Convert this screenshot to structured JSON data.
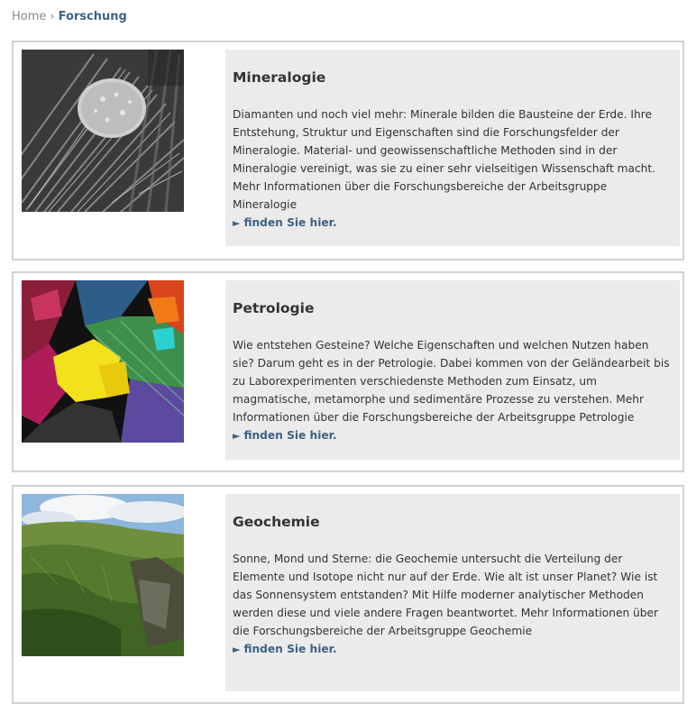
{
  "breadcrumb": {
    "home": "Home",
    "separator": "›",
    "current": "Forschung"
  },
  "cards": [
    {
      "title": "Mineralogie",
      "text": "Diamanten und noch viel mehr: Minerale bilden die Bausteine der Erde. Ihre Entstehung, Struktur und Eigenschaften sind die Forschungsfelder der Mineralogie. Material- und geowissenschaftliche Methoden sind in der Mineralogie vereinigt, was sie zu einer sehr vielseitigen Wissenschaft macht. Mehr Informationen über die Forschungsbereiche der Arbeitsgruppe Mineralogie",
      "link_arrow": "►",
      "link_label": "finden Sie hier."
    },
    {
      "title": "Petrologie",
      "text": "Wie entstehen Gesteine? Welche Eigenschaften und welchen Nutzen haben sie? Darum geht es in der Petrologie. Dabei kommen von der Geländearbeit bis zu Laborexperimenten verschiedenste Methoden zum Einsatz, um magmatische, metamorphe und sedimentäre Prozesse zu verstehen. Mehr Informationen über die Forschungsbereiche der Arbeitsgruppe Petrologie",
      "link_arrow": "►",
      "link_label": "finden Sie hier."
    },
    {
      "title": "Geochemie",
      "text": "Sonne, Mond und Sterne: die Geochemie untersucht die Verteilung der Elemente und Isotope nicht nur auf der Erde. Wie alt ist unser Planet? Wie ist das Sonnensystem entstanden? Mit Hilfe moderner analytischer Methoden werden diese und viele andere Fragen beantwortet. Mehr Informationen über die Forschungsbereiche der Arbeitsgruppe Geochemie",
      "link_arrow": "►",
      "link_label": "finden Sie hier."
    }
  ],
  "colors": {
    "link": "#3e6283",
    "panel_bg": "#ecebec",
    "card_border": "#cfd1d3"
  }
}
